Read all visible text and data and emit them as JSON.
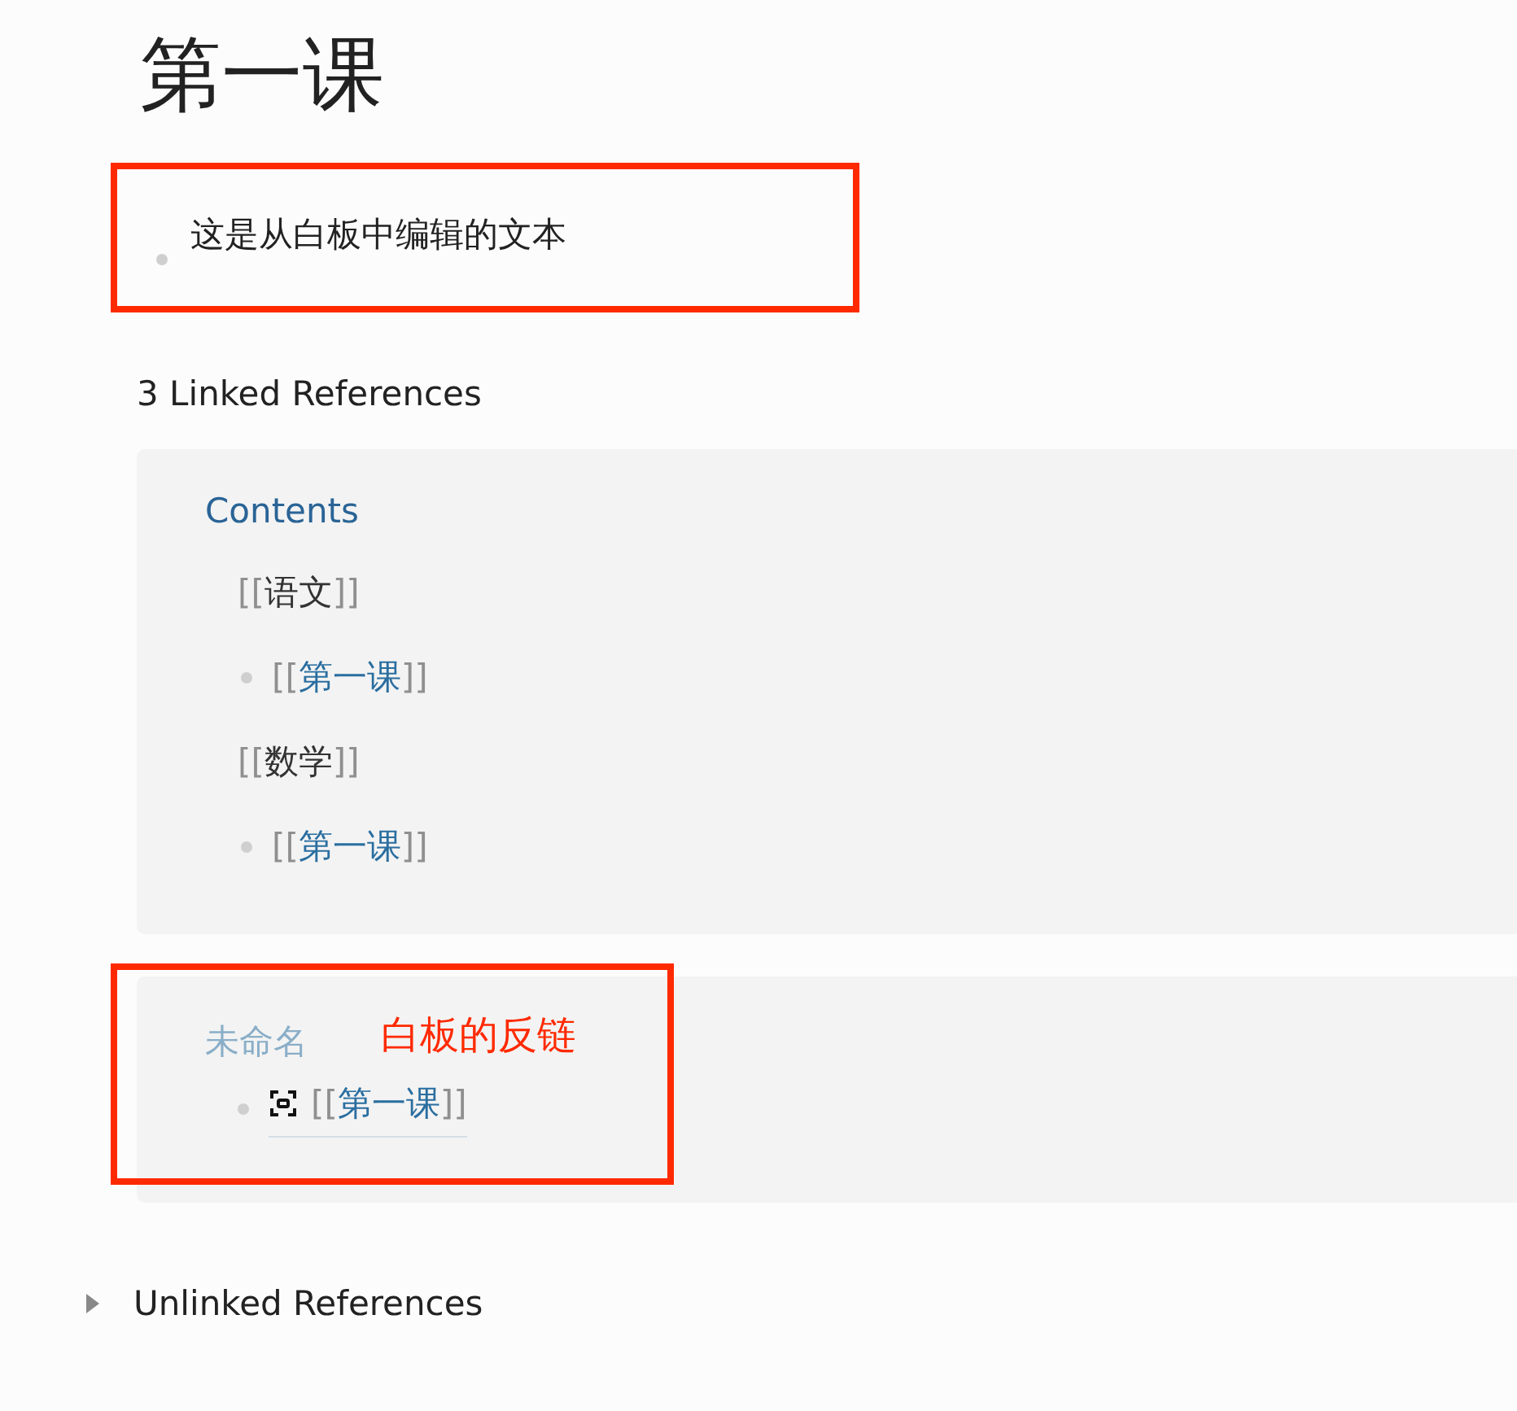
{
  "title": "第一课",
  "blocks": [
    {
      "text": "这是从白板中编辑的文本"
    }
  ],
  "linked_references": {
    "heading": "3 Linked References",
    "groups": [
      {
        "page": "Contents",
        "kind": "page",
        "items": [
          {
            "kind": "parent",
            "open": "[[",
            "text": "语文",
            "close": "]]",
            "children": [
              {
                "open": "[[",
                "text": "第一课",
                "close": "]]"
              }
            ]
          },
          {
            "kind": "parent",
            "open": "[[",
            "text": "数学",
            "close": "]]",
            "children": [
              {
                "open": "[[",
                "text": "第一课",
                "close": "]]"
              }
            ]
          }
        ]
      },
      {
        "page": "未命名",
        "kind": "whiteboard",
        "annotation": "白板的反链",
        "items": [
          {
            "kind": "whiteboard-block",
            "open": "[[",
            "text": "第一课",
            "close": "]]"
          }
        ]
      }
    ]
  },
  "unlinked_references": {
    "heading": "Unlinked References",
    "expanded": false
  }
}
